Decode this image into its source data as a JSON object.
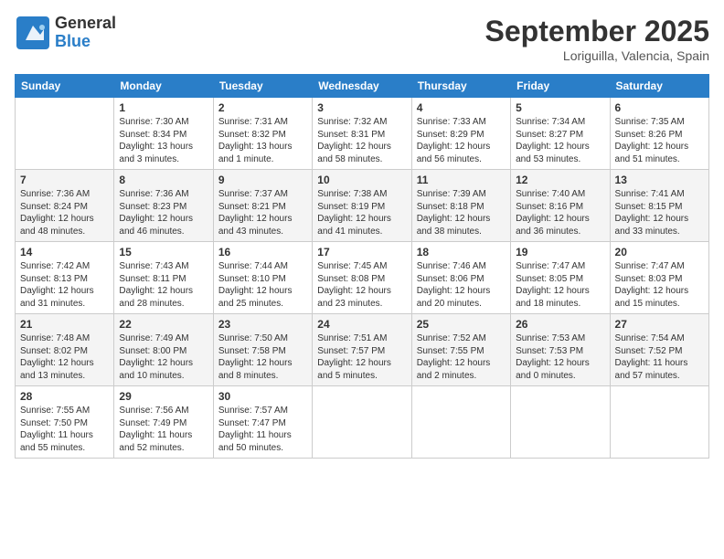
{
  "logo": {
    "general": "General",
    "blue": "Blue"
  },
  "title": {
    "month": "September 2025",
    "location": "Loriguilla, Valencia, Spain"
  },
  "days_of_week": [
    "Sunday",
    "Monday",
    "Tuesday",
    "Wednesday",
    "Thursday",
    "Friday",
    "Saturday"
  ],
  "weeks": [
    [
      {
        "day": "",
        "info": ""
      },
      {
        "day": "1",
        "info": "Sunrise: 7:30 AM\nSunset: 8:34 PM\nDaylight: 13 hours\nand 3 minutes."
      },
      {
        "day": "2",
        "info": "Sunrise: 7:31 AM\nSunset: 8:32 PM\nDaylight: 13 hours\nand 1 minute."
      },
      {
        "day": "3",
        "info": "Sunrise: 7:32 AM\nSunset: 8:31 PM\nDaylight: 12 hours\nand 58 minutes."
      },
      {
        "day": "4",
        "info": "Sunrise: 7:33 AM\nSunset: 8:29 PM\nDaylight: 12 hours\nand 56 minutes."
      },
      {
        "day": "5",
        "info": "Sunrise: 7:34 AM\nSunset: 8:27 PM\nDaylight: 12 hours\nand 53 minutes."
      },
      {
        "day": "6",
        "info": "Sunrise: 7:35 AM\nSunset: 8:26 PM\nDaylight: 12 hours\nand 51 minutes."
      }
    ],
    [
      {
        "day": "7",
        "info": "Sunrise: 7:36 AM\nSunset: 8:24 PM\nDaylight: 12 hours\nand 48 minutes."
      },
      {
        "day": "8",
        "info": "Sunrise: 7:36 AM\nSunset: 8:23 PM\nDaylight: 12 hours\nand 46 minutes."
      },
      {
        "day": "9",
        "info": "Sunrise: 7:37 AM\nSunset: 8:21 PM\nDaylight: 12 hours\nand 43 minutes."
      },
      {
        "day": "10",
        "info": "Sunrise: 7:38 AM\nSunset: 8:19 PM\nDaylight: 12 hours\nand 41 minutes."
      },
      {
        "day": "11",
        "info": "Sunrise: 7:39 AM\nSunset: 8:18 PM\nDaylight: 12 hours\nand 38 minutes."
      },
      {
        "day": "12",
        "info": "Sunrise: 7:40 AM\nSunset: 8:16 PM\nDaylight: 12 hours\nand 36 minutes."
      },
      {
        "day": "13",
        "info": "Sunrise: 7:41 AM\nSunset: 8:15 PM\nDaylight: 12 hours\nand 33 minutes."
      }
    ],
    [
      {
        "day": "14",
        "info": "Sunrise: 7:42 AM\nSunset: 8:13 PM\nDaylight: 12 hours\nand 31 minutes."
      },
      {
        "day": "15",
        "info": "Sunrise: 7:43 AM\nSunset: 8:11 PM\nDaylight: 12 hours\nand 28 minutes."
      },
      {
        "day": "16",
        "info": "Sunrise: 7:44 AM\nSunset: 8:10 PM\nDaylight: 12 hours\nand 25 minutes."
      },
      {
        "day": "17",
        "info": "Sunrise: 7:45 AM\nSunset: 8:08 PM\nDaylight: 12 hours\nand 23 minutes."
      },
      {
        "day": "18",
        "info": "Sunrise: 7:46 AM\nSunset: 8:06 PM\nDaylight: 12 hours\nand 20 minutes."
      },
      {
        "day": "19",
        "info": "Sunrise: 7:47 AM\nSunset: 8:05 PM\nDaylight: 12 hours\nand 18 minutes."
      },
      {
        "day": "20",
        "info": "Sunrise: 7:47 AM\nSunset: 8:03 PM\nDaylight: 12 hours\nand 15 minutes."
      }
    ],
    [
      {
        "day": "21",
        "info": "Sunrise: 7:48 AM\nSunset: 8:02 PM\nDaylight: 12 hours\nand 13 minutes."
      },
      {
        "day": "22",
        "info": "Sunrise: 7:49 AM\nSunset: 8:00 PM\nDaylight: 12 hours\nand 10 minutes."
      },
      {
        "day": "23",
        "info": "Sunrise: 7:50 AM\nSunset: 7:58 PM\nDaylight: 12 hours\nand 8 minutes."
      },
      {
        "day": "24",
        "info": "Sunrise: 7:51 AM\nSunset: 7:57 PM\nDaylight: 12 hours\nand 5 minutes."
      },
      {
        "day": "25",
        "info": "Sunrise: 7:52 AM\nSunset: 7:55 PM\nDaylight: 12 hours\nand 2 minutes."
      },
      {
        "day": "26",
        "info": "Sunrise: 7:53 AM\nSunset: 7:53 PM\nDaylight: 12 hours\nand 0 minutes."
      },
      {
        "day": "27",
        "info": "Sunrise: 7:54 AM\nSunset: 7:52 PM\nDaylight: 11 hours\nand 57 minutes."
      }
    ],
    [
      {
        "day": "28",
        "info": "Sunrise: 7:55 AM\nSunset: 7:50 PM\nDaylight: 11 hours\nand 55 minutes."
      },
      {
        "day": "29",
        "info": "Sunrise: 7:56 AM\nSunset: 7:49 PM\nDaylight: 11 hours\nand 52 minutes."
      },
      {
        "day": "30",
        "info": "Sunrise: 7:57 AM\nSunset: 7:47 PM\nDaylight: 11 hours\nand 50 minutes."
      },
      {
        "day": "",
        "info": ""
      },
      {
        "day": "",
        "info": ""
      },
      {
        "day": "",
        "info": ""
      },
      {
        "day": "",
        "info": ""
      }
    ]
  ]
}
